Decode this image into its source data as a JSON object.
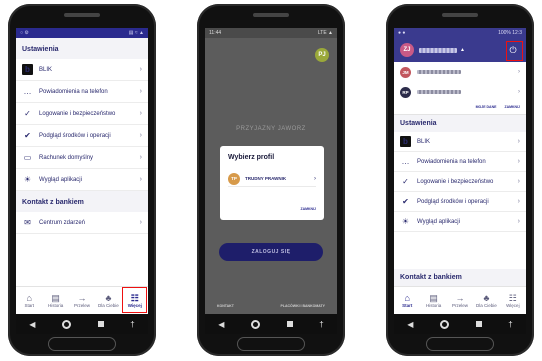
{
  "colors": {
    "brand": "#2a2a8e",
    "header_purple": "#3a3a8e",
    "highlight": "#ee1111"
  },
  "phone1": {
    "status_left": "○ ⚙",
    "status_right": "▤ ≈ ▲",
    "settings_title": "Ustawienia",
    "settings_items": [
      {
        "icon": "blik-logo",
        "glyph": "b",
        "label": "BLIK"
      },
      {
        "icon": "chat-bubble-icon",
        "glyph": "…",
        "label": "Powiadomienia na telefon"
      },
      {
        "icon": "lock-icon",
        "glyph": "✓",
        "label": "Logowanie i bezpieczeństwo"
      },
      {
        "icon": "money-check-icon",
        "glyph": "✔",
        "label": "Podgląd środków i operacji"
      },
      {
        "icon": "wallet-icon",
        "glyph": "▭",
        "label": "Rachunek domyślny"
      },
      {
        "icon": "sun-icon",
        "glyph": "☀",
        "label": "Wygląd aplikacji"
      }
    ],
    "contact_title": "Kontakt z bankiem",
    "contact_items": [
      {
        "icon": "message-center-icon",
        "glyph": "✉",
        "label": "Centrum zdarzeń"
      }
    ],
    "tabs": [
      {
        "icon": "home-icon",
        "glyph": "⌂",
        "label": "Start"
      },
      {
        "icon": "history-icon",
        "glyph": "▤",
        "label": "Historia"
      },
      {
        "icon": "transfer-icon",
        "glyph": "→",
        "label": "Przelew"
      },
      {
        "icon": "tag-icon",
        "glyph": "♣",
        "label": "Dla Ciebie"
      },
      {
        "icon": "grid-icon",
        "glyph": "☷",
        "label": "Więcej"
      }
    ],
    "chevron": "›"
  },
  "phone2": {
    "status_time": "11:44",
    "status_right": "LTE ▲",
    "avatar_initials": "PJ",
    "bank_name": "PRZYJAZNY JAWORZ",
    "dialog_title": "Wybierz profil",
    "profile_initials": "TP",
    "profile_name": "TRUDNY PRAWNIK",
    "dialog_close": "ZAMKNIJ",
    "login_button": "ZALOGUJ SIĘ",
    "link_contact": "KONTAKT",
    "link_branches": "PLACÓWKI I BANKOMATY",
    "chevron": "›"
  },
  "phone3": {
    "status_right": "100% 12:3",
    "user_initials": "ZJ",
    "power_glyph": "⏻",
    "accounts": [
      {
        "initials": "JM",
        "color": "#c2575e"
      },
      {
        "initials": "RP",
        "color": "#2c2c4a"
      }
    ],
    "link_my_data": "MOJE DANE",
    "link_close": "ZAMKNIJ",
    "settings_title": "Ustawienia",
    "settings_items": [
      {
        "icon": "blik-logo",
        "glyph": "b",
        "label": "BLIK"
      },
      {
        "icon": "chat-bubble-icon",
        "glyph": "…",
        "label": "Powiadomienia na telefon"
      },
      {
        "icon": "lock-icon",
        "glyph": "✓",
        "label": "Logowanie i bezpieczeństwo"
      },
      {
        "icon": "money-check-icon",
        "glyph": "✔",
        "label": "Podgląd środków i operacji"
      },
      {
        "icon": "sun-icon",
        "glyph": "☀",
        "label": "Wygląd aplikacji"
      }
    ],
    "contact_title": "Kontakt z bankiem",
    "tabs": [
      {
        "icon": "home-icon",
        "glyph": "⌂",
        "label": "Start"
      },
      {
        "icon": "history-icon",
        "glyph": "▤",
        "label": "Historia"
      },
      {
        "icon": "transfer-icon",
        "glyph": "→",
        "label": "Przelew"
      },
      {
        "icon": "tag-icon",
        "glyph": "♣",
        "label": "Dla Ciebie"
      },
      {
        "icon": "grid-icon",
        "glyph": "☷",
        "label": "Więcej"
      }
    ],
    "chevron": "›"
  },
  "android_nav": {
    "back": "◀",
    "drawer": "†"
  }
}
